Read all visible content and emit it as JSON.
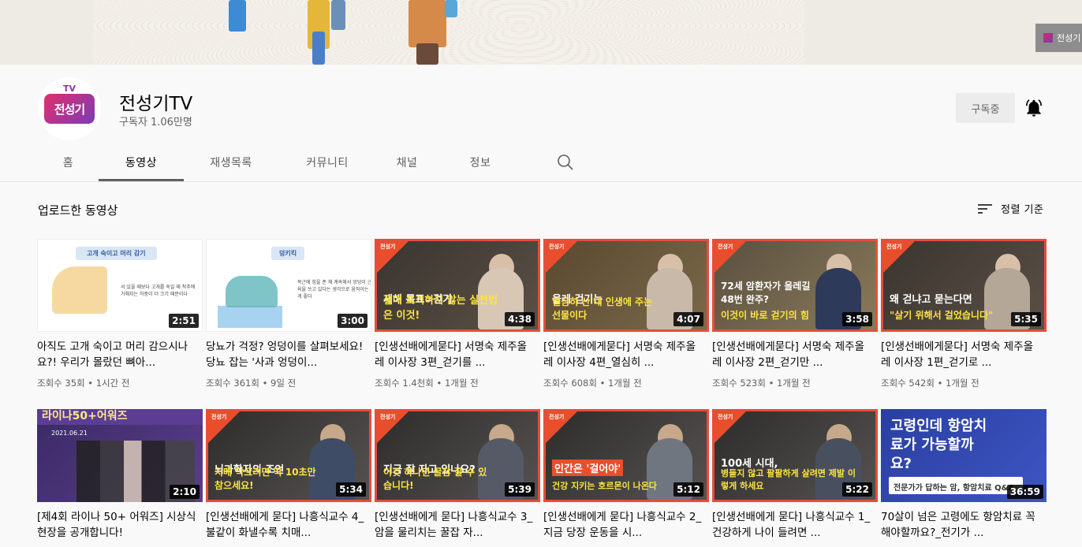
{
  "banner": {
    "badge_text": "전성기"
  },
  "channel": {
    "avatar_tv": "TV",
    "avatar_name": "전성기",
    "name": "전성기TV",
    "subscribers": "구독자 1.06만명",
    "subscribe_label": "구독중"
  },
  "tabs": [
    {
      "label": "홈"
    },
    {
      "label": "동영상"
    },
    {
      "label": "재생목록"
    },
    {
      "label": "커뮤니티"
    },
    {
      "label": "채널"
    },
    {
      "label": "정보"
    }
  ],
  "section": {
    "title": "업로드한 동영상",
    "sort_label": "정렬 기준"
  },
  "videos": [
    {
      "title": "아직도 고개 숙이고 머리 감으시나요?! 우리가 몰랐던 뼈아...",
      "meta": "조회수 35회 • 1시간 전",
      "duration": "2:51",
      "thumb_label": "고개 숙이고 머리 감기",
      "thumb_desc": "서 있을 때보다 고개를 숙일 때 척추에 가해지는 하중이 더 크기 때문이다"
    },
    {
      "title": "당뇨가 걱정? 엉덩이를 살펴보세요! 당뇨 잡는 '사과 엉덩이...",
      "meta": "조회수 361회 • 9일 전",
      "duration": "3:00",
      "thumb_label": "덩키킥",
      "thumb_desc": "복근에 힘을 준 채 계속해서 엉덩이 근육을 쓰고 있다는 생각으로 움직이는 게 좋다"
    },
    {
      "title": "[인생선배에게묻다] 서명숙 제주올레 이사장 3편_걷기를 ...",
      "meta": "조회수 1.4천회 • 1개월 전",
      "duration": "4:38",
      "cap1": "새해 목표=걷기",
      "cap2": "절대 포기하지 않는 실천법은 이것!",
      "corner": "전성기 할아가는 시리즈"
    },
    {
      "title": "[인생선배에게묻다] 서명숙 제주올레 이사장 4편_열심히 ...",
      "meta": "조회수 608회 • 1개월 전",
      "duration": "4:07",
      "cap1": "올레 걷기는",
      "cap2": "열심히 산 내 인생에 주는 선물이다",
      "corner": "전성기 할아가는 시리즈"
    },
    {
      "title": "[인생선배에게묻다] 서명숙 제주올레 이사장 2편_걷기만 ...",
      "meta": "조회수 523회 • 1개월 전",
      "duration": "3:58",
      "cap1": "72세 암환자가 올레길 48번 완주?",
      "cap2": "이것이 바로 걷기의 힘",
      "corner": "전성기 할아가는 시리즈"
    },
    {
      "title": "[인생선배에게묻다] 서명숙 제주올레 이사장 1편_걷기로 ...",
      "meta": "조회수 542회 • 1개월 전",
      "duration": "5:35",
      "cap1": "왜 걷냐고 묻는다면",
      "cap2": "\"살기 위해서 걸었습니다\"",
      "corner": "전성기 할아가는 시리즈"
    },
    {
      "title": "[제4회 라이나 50+ 어워즈] 시상식 현장을 공개합니다!",
      "meta": "",
      "duration": "2:10",
      "cap1": "라이나50+어워즈",
      "cap2": "2021.06.21"
    },
    {
      "title": "[인생선배에게 묻다] 나흥식교수 4_ 불같이 화낼수록 치매...",
      "meta": "",
      "duration": "5:34",
      "cap1": "뇌과학자의 조언",
      "cap2": "치매 막으려면 딱 10초만 참으세요!",
      "corner": "전성기 할아가는 시리즈"
    },
    {
      "title": "[인생선배에게 묻다] 나흥식교수 3_ 암을 물리치는 꿀잡 자...",
      "meta": "",
      "duration": "5:39",
      "cap1": "지금 잘 자고 있나요?",
      "cap2": "이것 하나면 꿀잠 잘 수 있습니다!",
      "corner": "전성기 할아가는 시리즈"
    },
    {
      "title": "[인생선배에게 묻다] 나흥식교수 2_지금 당장 운동을 시...",
      "meta": "",
      "duration": "5:12",
      "cap1": "인간은 '걸어야'",
      "cap2": "건강 지키는 호르몬이 나온다",
      "corner": "전성기 할아가는 시리즈"
    },
    {
      "title": "[인생선배에게 묻다] 나흥식교수 1_ 건강하게 나이 들려면 ...",
      "meta": "",
      "duration": "5:22",
      "cap1": "100세 시대,",
      "cap2": "병들지 않고 팔팔하게 살려면 제발 이렇게 하세요",
      "corner": "전성기 할아가는 시리즈"
    },
    {
      "title": "70살이 넘은 고령에도 항암치료 꼭 해야할까요?_전기가 ...",
      "meta": "",
      "duration": "36:59",
      "cap1": "고령인데 항암치료가 가능할까요?",
      "cap2": "전문가가 답하는 암, 항암치료 Q&A"
    }
  ],
  "colors": {
    "accent_red": "#e94e2c",
    "caption_yellow": "#fce441",
    "tab_underline": "#606060"
  }
}
